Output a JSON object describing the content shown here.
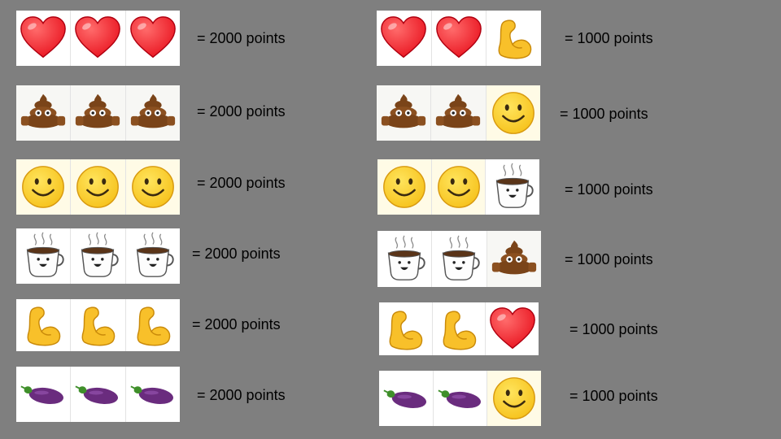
{
  "left_rows": [
    {
      "icons": [
        "heart-icon",
        "heart-icon",
        "heart-icon"
      ],
      "text": "= 2000 points"
    },
    {
      "icons": [
        "poop-icon",
        "poop-icon",
        "poop-icon"
      ],
      "text": "= 2000 points"
    },
    {
      "icons": [
        "smiley-icon",
        "smiley-icon",
        "smiley-icon"
      ],
      "text": "= 2000 points"
    },
    {
      "icons": [
        "coffee-icon",
        "coffee-icon",
        "coffee-icon"
      ],
      "text": "= 2000 points"
    },
    {
      "icons": [
        "bicep-icon",
        "bicep-icon",
        "bicep-icon"
      ],
      "text": "= 2000 points"
    },
    {
      "icons": [
        "eggplant-icon",
        "eggplant-icon",
        "eggplant-icon"
      ],
      "text": "= 2000 points"
    }
  ],
  "right_rows": [
    {
      "icons": [
        "heart-icon",
        "heart-icon",
        "bicep-icon"
      ],
      "text": "= 1000 points"
    },
    {
      "icons": [
        "poop-icon",
        "poop-icon",
        "smiley-icon"
      ],
      "text": "= 1000 points"
    },
    {
      "icons": [
        "smiley-icon",
        "smiley-icon",
        "coffee-icon"
      ],
      "text": "= 1000 points"
    },
    {
      "icons": [
        "coffee-icon",
        "coffee-icon",
        "poop-icon"
      ],
      "text": "= 1000 points"
    },
    {
      "icons": [
        "bicep-icon",
        "bicep-icon",
        "heart-icon"
      ],
      "text": "= 1000 points"
    },
    {
      "icons": [
        "eggplant-icon",
        "eggplant-icon",
        "smiley-icon"
      ],
      "text": "= 1000 points"
    }
  ],
  "colors": {
    "background": "#7f7f7f",
    "heart": "#e8101c",
    "smiley": "#f6c21c",
    "bicep": "#f8c02a",
    "eggplant": "#6a2c7e",
    "poop": "#7a4419"
  }
}
